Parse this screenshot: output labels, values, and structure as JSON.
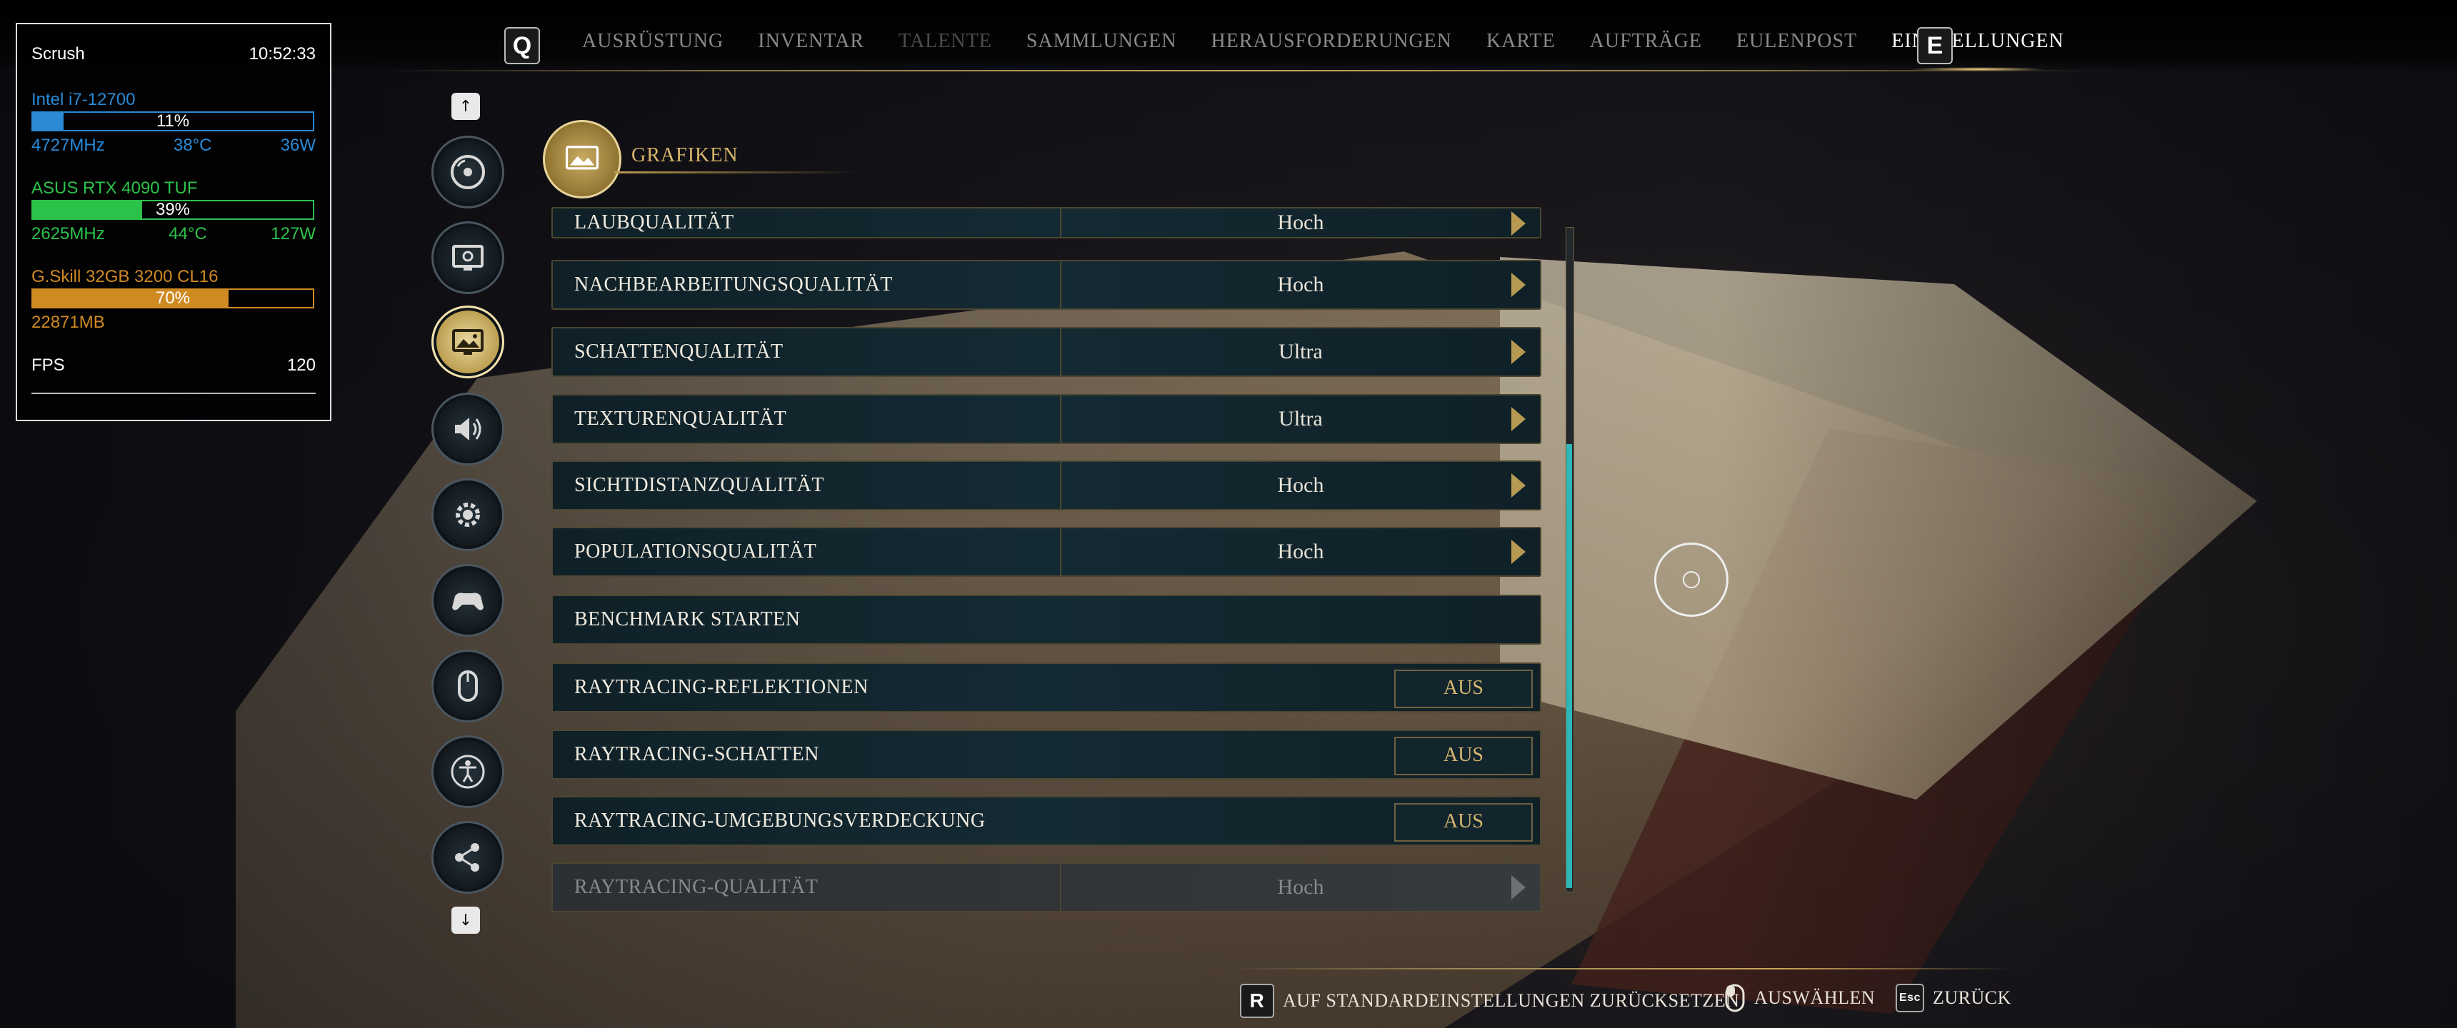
{
  "nav": {
    "left_key": "Q",
    "right_key": "E",
    "tabs": [
      {
        "label": "AUSRÜSTUNG",
        "state": "normal"
      },
      {
        "label": "INVENTAR",
        "state": "normal"
      },
      {
        "label": "TALENTE",
        "state": "dim"
      },
      {
        "label": "SAMMLUNGEN",
        "state": "normal"
      },
      {
        "label": "HERAUSFORDERUNGEN",
        "state": "normal"
      },
      {
        "label": "KARTE",
        "state": "normal"
      },
      {
        "label": "AUFTRÄGE",
        "state": "normal"
      },
      {
        "label": "EULENPOST",
        "state": "normal"
      },
      {
        "label": "EINSTELLUNGEN",
        "state": "active"
      }
    ]
  },
  "overlay": {
    "name": "Scrush",
    "time": "10:52:33",
    "cpu": {
      "name": "Intel i7-12700",
      "usage": "11%",
      "usage_fraction": 0.11,
      "clock": "4727MHz",
      "temp": "38°C",
      "power": "36W",
      "color": "#2a8ad6"
    },
    "gpu": {
      "name": "ASUS RTX 4090 TUF",
      "usage": "39%",
      "usage_fraction": 0.39,
      "clock": "2625MHz",
      "temp": "44°C",
      "power": "127W",
      "color": "#2cc24a"
    },
    "ram": {
      "name": "G.Skill 32GB 3200 CL16",
      "usage": "70%",
      "usage_fraction": 0.7,
      "used": "22871MB",
      "color": "#d08a22"
    },
    "fps_label": "FPS",
    "fps": "120"
  },
  "sidebar": {
    "up_key": "↑",
    "down_key": "↓",
    "items": [
      {
        "icon": "disc-icon",
        "active": false
      },
      {
        "icon": "display-icon",
        "active": false
      },
      {
        "icon": "graphics-icon",
        "active": true
      },
      {
        "icon": "audio-icon",
        "active": false
      },
      {
        "icon": "gameplay-gear-icon",
        "active": false
      },
      {
        "icon": "gamepad-icon",
        "active": false
      },
      {
        "icon": "mouse-icon",
        "active": false
      },
      {
        "icon": "accessibility-icon",
        "active": false
      },
      {
        "icon": "share-icon",
        "active": false
      }
    ]
  },
  "section": {
    "title": "GRAFIKEN"
  },
  "settings": [
    {
      "label": "LAUBQUALITÄT",
      "value": "Hoch",
      "type": "select",
      "clipped": true
    },
    {
      "label": "NACHBEARBEITUNGSQUALITÄT",
      "value": "Hoch",
      "type": "select"
    },
    {
      "label": "SCHATTENQUALITÄT",
      "value": "Ultra",
      "type": "select"
    },
    {
      "label": "TEXTURENQUALITÄT",
      "value": "Ultra",
      "type": "select"
    },
    {
      "label": "SICHTDISTANZQUALITÄT",
      "value": "Hoch",
      "type": "select"
    },
    {
      "label": "POPULATIONSQUALITÄT",
      "value": "Hoch",
      "type": "select"
    },
    {
      "label": "BENCHMARK STARTEN",
      "value": "",
      "type": "button"
    },
    {
      "label": "RAYTRACING-REFLEKTIONEN",
      "value": "AUS",
      "type": "toggle"
    },
    {
      "label": "RAYTRACING-SCHATTEN",
      "value": "AUS",
      "type": "toggle"
    },
    {
      "label": "RAYTRACING-UMGEBUNGSVERDECKUNG",
      "value": "AUS",
      "type": "toggle"
    },
    {
      "label": "RAYTRACING-QUALITÄT",
      "value": "Hoch",
      "type": "select",
      "disabled": true
    }
  ],
  "prompts": [
    {
      "key": "R",
      "label": "AUF STANDARDEINSTELLUNGEN ZURÜCKSETZEN"
    },
    {
      "key": "mouse",
      "label": "AUSWÄHLEN"
    },
    {
      "key": "Esc",
      "label": "ZURÜCK"
    }
  ],
  "colors": {
    "accent_gold": "#d8b66a",
    "scroll_teal": "#2fb7b7",
    "toggle_text": "#d7b670"
  }
}
